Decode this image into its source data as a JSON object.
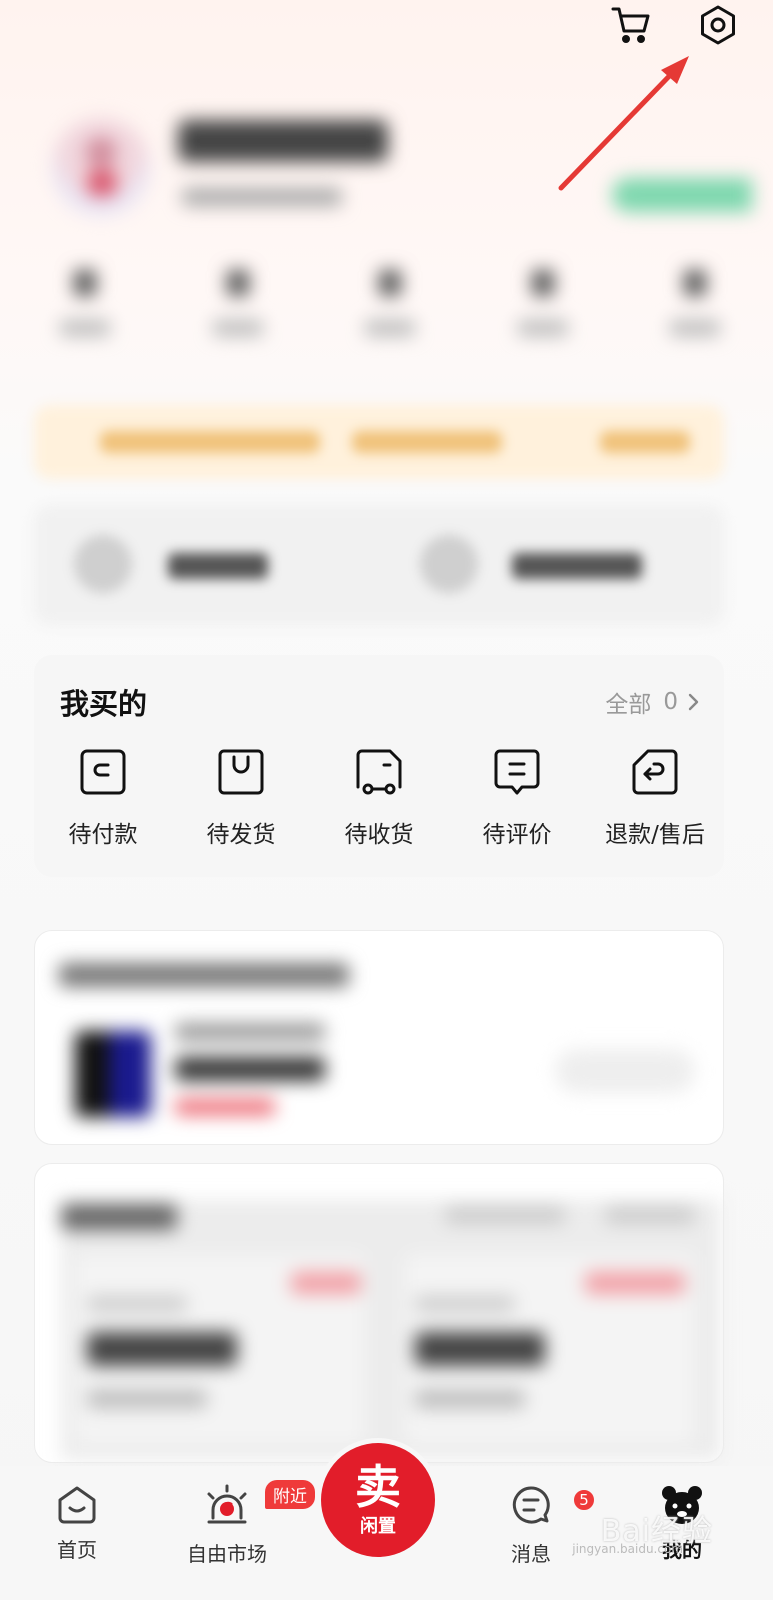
{
  "orders": {
    "title": "我买的",
    "all_label": "全部",
    "all_count": "0",
    "items": [
      {
        "label": "待付款",
        "icon": "wallet-icon"
      },
      {
        "label": "待发货",
        "icon": "box-icon"
      },
      {
        "label": "待收货",
        "icon": "truck-icon"
      },
      {
        "label": "待评价",
        "icon": "review-icon"
      },
      {
        "label": "退款/售后",
        "icon": "refund-icon"
      }
    ]
  },
  "nav": {
    "home": "首页",
    "market": "自由市场",
    "market_badge": "附近",
    "sell_big": "卖",
    "sell_small": "闲置",
    "messages": "消息",
    "messages_badge": "5",
    "mine": "我的"
  },
  "watermark": {
    "text": "Bai经验",
    "sub": "jingyan.baidu.com"
  },
  "colors": {
    "accent": "#e21d2a",
    "badge": "#ef3a3a",
    "annotation_arrow": "#e53935"
  }
}
